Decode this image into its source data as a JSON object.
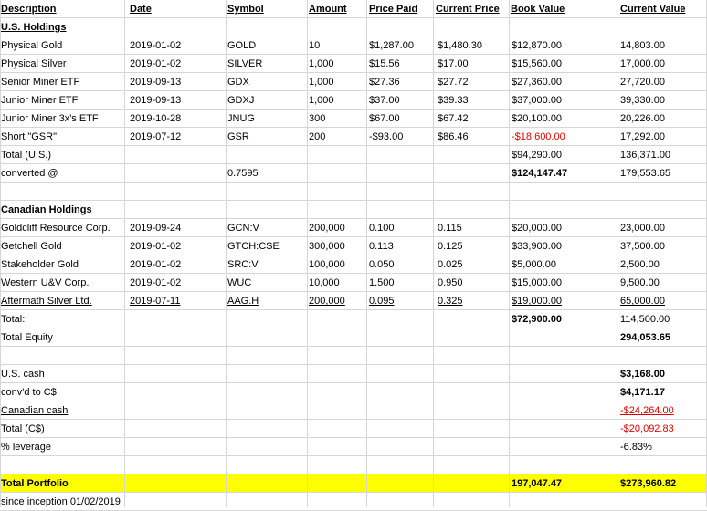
{
  "header": {
    "description": "Description",
    "date": "Date",
    "symbol": "Symbol",
    "amount": "Amount",
    "price_paid": "Price Paid",
    "current_price": "Current Price",
    "book_value": "Book Value",
    "current_value": "Current Value"
  },
  "rows": [
    {
      "desc": "U.S. Holdings",
      "desc_bold": true,
      "desc_ul": true
    },
    {
      "desc": "Physical Gold",
      "date": "2019-01-02",
      "symbol": "GOLD",
      "amount": "10",
      "paid": "$1,287.00",
      "cur": "$1,480.30",
      "book": "$12,870.00",
      "value": "14,803.00"
    },
    {
      "desc": "Physical Silver",
      "date": "2019-01-02",
      "symbol": "SILVER",
      "amount": "1,000",
      "paid": "$15.56",
      "cur": "$17.00",
      "book": "$15,560.00",
      "value": "17,000.00"
    },
    {
      "desc": "Senior Miner ETF",
      "date": "2019-09-13",
      "symbol": "GDX",
      "amount": "1,000",
      "paid": "$27.36",
      "cur": "$27.72",
      "book": "$27,360.00",
      "value": "27,720.00"
    },
    {
      "desc": "Junior Miner ETF",
      "date": "2019-09-13",
      "symbol": "GDXJ",
      "amount": "1,000",
      "paid": "$37.00",
      "cur": "$39.33",
      "book": "$37,000.00",
      "value": "39,330.00"
    },
    {
      "desc": "Junior Miner 3x's ETF",
      "date": "2019-10-28",
      "symbol": "JNUG",
      "amount": "300",
      "paid": "$67.00",
      "cur": "$67.42",
      "book": "$20,100.00",
      "value": "20,226.00"
    },
    {
      "desc": "Short \"GSR\"",
      "date": "2019-07-12",
      "symbol": "GSR",
      "amount": "200",
      "paid": "-$93.00",
      "cur": "$86.46",
      "book": "-$18,600.00",
      "value": "17,292.00",
      "underline": true,
      "book_red": true
    },
    {
      "desc": "Total (U.S.)",
      "book": "$94,290.00",
      "value": "136,371.00"
    },
    {
      "desc": "converted @",
      "symbol": "0.7595",
      "book": "$124,147.47",
      "book_bold": true,
      "value": "179,553.65"
    },
    {
      "desc": ""
    },
    {
      "desc": "Canadian Holdings",
      "desc_bold": true,
      "desc_ul": true
    },
    {
      "desc": "Goldcliff Resource Corp.",
      "date": "2019-09-24",
      "symbol": "GCN:V",
      "amount": "200,000",
      "paid": "0.100",
      "cur": "0.115",
      "book": "$20,000.00",
      "value": "23,000.00"
    },
    {
      "desc": "Getchell Gold",
      "date": "2019-01-02",
      "symbol": "GTCH:CSE",
      "amount": "300,000",
      "paid": "0.113",
      "cur": "0.125",
      "book": "$33,900.00",
      "value": "37,500.00"
    },
    {
      "desc": "Stakeholder Gold",
      "date": "2019-01-02",
      "symbol": "SRC:V",
      "amount": "100,000",
      "paid": "0.050",
      "cur": "0.025",
      "book": "$5,000.00",
      "value": "2,500.00"
    },
    {
      "desc": "Western U&V Corp.",
      "date": "2019-01-02",
      "symbol": "WUC",
      "amount": "10,000",
      "paid": "1.500",
      "cur": "0.950",
      "book": "$15,000.00",
      "value": "9,500.00"
    },
    {
      "desc": "Aftermath Silver Ltd.",
      "date": "2019-07-11",
      "symbol": "AAG.H",
      "amount": "200,000",
      "paid": "0.095",
      "cur": "0.325",
      "book": "$19,000.00",
      "value": "65,000.00",
      "underline": true
    },
    {
      "desc": "Total:",
      "book": "$72,900.00",
      "book_bold": true,
      "value": "114,500.00"
    },
    {
      "desc": "Total Equity",
      "value": "294,053.65",
      "value_bold": true
    },
    {
      "desc": ""
    },
    {
      "desc": "U.S. cash",
      "value": "$3,168.00",
      "value_bold": true
    },
    {
      "desc": "conv'd to C$",
      "value": "$4,171.17",
      "value_bold": true
    },
    {
      "desc": "Canadian cash",
      "value": "-$24,264.00",
      "value_red": true,
      "underline_desc_value": true
    },
    {
      "desc": "Total (C$)",
      "value": "-$20,092.83",
      "value_red": true
    },
    {
      "desc": "% leverage",
      "value": "-6.83%"
    },
    {
      "desc": ""
    },
    {
      "desc": "Total Portfolio",
      "book": "197,047.47",
      "value": "$273,960.82",
      "all_bold": true,
      "highlight": true
    },
    {
      "desc": "since inception 01/02/2019"
    }
  ]
}
